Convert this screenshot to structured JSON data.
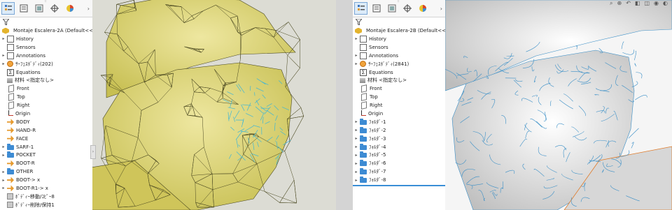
{
  "pane_a": {
    "root_label": "Montaje Escalera-2A  (Default<<Default",
    "tree": [
      {
        "label": "History",
        "icon": "history-icon",
        "expand": true
      },
      {
        "label": "Sensors",
        "icon": "sensors-icon",
        "expand": false
      },
      {
        "label": "Annotations",
        "icon": "annotations-icon",
        "expand": true
      },
      {
        "label": "ｻｰﾌｪｽﾎﾞﾃﾞｨ(202)",
        "icon": "surface-bodies-icon",
        "expand": true
      },
      {
        "label": "Equations",
        "icon": "equations-icon",
        "expand": false
      },
      {
        "label": "材料 <指定なし>",
        "icon": "material-icon",
        "expand": false
      },
      {
        "label": "Front",
        "icon": "plane-icon",
        "expand": false
      },
      {
        "label": "Top",
        "icon": "plane-icon",
        "expand": false
      },
      {
        "label": "Right",
        "icon": "plane-icon",
        "expand": false
      },
      {
        "label": "Origin",
        "icon": "origin-icon",
        "expand": false
      },
      {
        "label": "BODY",
        "icon": "feature-icon",
        "expand": false
      },
      {
        "label": "HAND-R",
        "icon": "feature-icon",
        "expand": false
      },
      {
        "label": "FACE",
        "icon": "feature-icon",
        "expand": false
      },
      {
        "label": "SARF-1",
        "icon": "folder-icon",
        "expand": true
      },
      {
        "label": "POCKET",
        "icon": "folder-icon",
        "expand": true
      },
      {
        "label": "BOOT-R",
        "icon": "feature-icon",
        "expand": false
      },
      {
        "label": "OTHER",
        "icon": "folder-icon",
        "expand": true
      },
      {
        "label": "BOOT-> x",
        "icon": "feature-icon",
        "expand": true
      },
      {
        "label": "BOOT-R1-> x",
        "icon": "feature-icon",
        "expand": true
      },
      {
        "label": "ﾎﾞﾃﾞｨｰ移動/ｺﾋﾟｰ8",
        "icon": "move-body-icon",
        "expand": false
      },
      {
        "label": "ﾎﾞﾃﾞｨｰ削除/保持1",
        "icon": "delete-body-icon",
        "expand": false
      }
    ]
  },
  "pane_b": {
    "root_label": "Montaje Escalera-2B  (Default<<Default",
    "tree": [
      {
        "label": "History",
        "icon": "history-icon",
        "expand": true
      },
      {
        "label": "Sensors",
        "icon": "sensors-icon",
        "expand": false
      },
      {
        "label": "Annotations",
        "icon": "annotations-icon",
        "expand": true
      },
      {
        "label": "ｻｰﾌｪｽﾎﾞﾃﾞｨ(2841)",
        "icon": "surface-bodies-icon",
        "expand": true
      },
      {
        "label": "Equations",
        "icon": "equations-icon",
        "expand": false
      },
      {
        "label": "材料 <指定なし>",
        "icon": "material-icon",
        "expand": false
      },
      {
        "label": "Front",
        "icon": "plane-icon",
        "expand": false
      },
      {
        "label": "Top",
        "icon": "plane-icon",
        "expand": false
      },
      {
        "label": "Right",
        "icon": "plane-icon",
        "expand": false
      },
      {
        "label": "Origin",
        "icon": "origin-icon",
        "expand": false
      },
      {
        "label": "ﾌｫﾙﾀﾞ-1",
        "icon": "folder-icon",
        "expand": true
      },
      {
        "label": "ﾌｫﾙﾀﾞ-2",
        "icon": "folder-icon",
        "expand": true
      },
      {
        "label": "ﾌｫﾙﾀﾞ-3",
        "icon": "folder-icon",
        "expand": true
      },
      {
        "label": "ﾌｫﾙﾀﾞ-4",
        "icon": "folder-icon",
        "expand": true
      },
      {
        "label": "ﾌｫﾙﾀﾞ-5",
        "icon": "folder-icon",
        "expand": true
      },
      {
        "label": "ﾌｫﾙﾀﾞ-6",
        "icon": "folder-icon",
        "expand": true
      },
      {
        "label": "ﾌｫﾙﾀﾞ-7",
        "icon": "folder-icon",
        "expand": true
      },
      {
        "label": "ﾌｫﾙﾀﾞ-8",
        "icon": "folder-icon",
        "expand": true
      }
    ]
  },
  "colors": {
    "model_a_fill": "#d8d06a",
    "model_a_edge": "#4a4820",
    "model_a_highlight": "#3fb6d6",
    "model_b_fill": "#e9e9e9",
    "model_b_edge": "#3a8fc7",
    "selection_line": "#3a8ed6"
  }
}
